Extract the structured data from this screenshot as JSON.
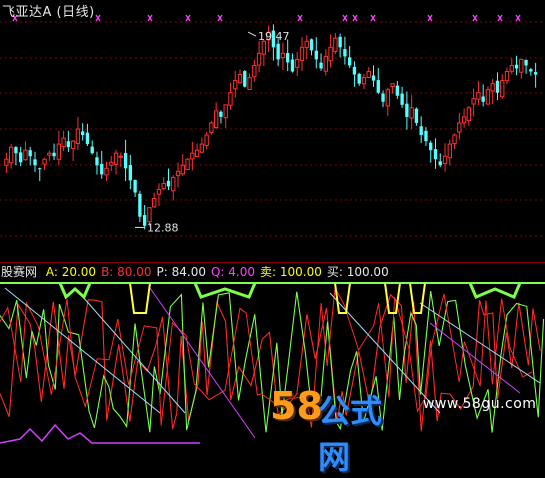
{
  "window": {
    "title": "飞亚达A (日线)"
  },
  "price_annotations": {
    "high_label": "19.47",
    "low_label": "12.88"
  },
  "indicator": {
    "name": "股赛网",
    "params": [
      {
        "key": "A",
        "label": "A:",
        "value": "20.00",
        "color": "#ffff00"
      },
      {
        "key": "B",
        "label": "B:",
        "value": "80.00",
        "color": "#ff3030"
      },
      {
        "key": "P",
        "label": "P:",
        "value": "84.00",
        "color": "#e8e8e8"
      },
      {
        "key": "Q",
        "label": "Q:",
        "value": "4.00",
        "color": "#ff40ff"
      },
      {
        "key": "sell",
        "label": "卖:",
        "value": "100.00",
        "color": "#ffff00"
      },
      {
        "key": "buy",
        "label": "买:",
        "value": "100.00",
        "color": "#e8e8e8"
      }
    ]
  },
  "watermark": {
    "brand_number": "58",
    "brand_text": "公式网",
    "url": "www.58gu.com"
  },
  "colors": {
    "up_candle": "#ff3030",
    "down_candle": "#54ffff",
    "grid": "#8a0000",
    "marker": "#ff40ff",
    "indicator_green": "#7cff4c",
    "indicator_red": "#ff2a2a",
    "indicator_yellow": "#ffff40",
    "indicator_magenta": "#d040ff",
    "indicator_cyan": "#a0e0ff"
  },
  "chart_data": {
    "type": "candlestick",
    "title": "飞亚达A (日线)",
    "high": 19.47,
    "low": 12.88,
    "ylim": [
      12.2,
      20.2
    ],
    "closes": [
      15.2,
      15.6,
      15.4,
      15.1,
      15.5,
      15.3,
      15.0,
      14.9,
      15.2,
      15.4,
      15.3,
      15.7,
      15.9,
      15.6,
      15.8,
      16.2,
      16.0,
      15.7,
      15.4,
      15.0,
      14.7,
      14.9,
      15.1,
      15.4,
      15.3,
      14.9,
      14.5,
      14.1,
      13.3,
      13.0,
      13.6,
      13.9,
      14.2,
      14.4,
      14.3,
      14.6,
      14.8,
      15.0,
      15.2,
      15.4,
      15.5,
      15.7,
      16.0,
      16.4,
      16.8,
      16.6,
      17.0,
      17.4,
      17.8,
      18.0,
      17.6,
      17.9,
      18.3,
      18.7,
      19.1,
      19.4,
      18.9,
      18.5,
      18.7,
      18.4,
      18.1,
      18.5,
      18.9,
      19.1,
      18.8,
      18.5,
      18.2,
      18.6,
      18.9,
      19.2,
      18.9,
      18.6,
      18.3,
      18.0,
      17.7,
      17.9,
      18.1,
      17.8,
      17.4,
      17.1,
      17.5,
      17.7,
      17.3,
      17.0,
      16.6,
      16.9,
      16.4,
      16.0,
      15.8,
      15.5,
      15.2,
      15.0,
      15.3,
      15.7,
      16.0,
      16.4,
      16.6,
      16.9,
      17.2,
      17.4,
      17.1,
      17.5,
      17.7,
      17.4,
      17.8,
      18.1,
      18.3,
      18.2,
      18.5,
      18.3,
      18.1,
      18.0
    ]
  }
}
